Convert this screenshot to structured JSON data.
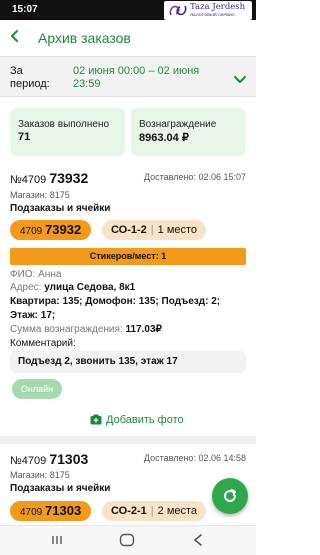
{
  "status_bar": {
    "time": "15:07"
  },
  "logo": {
    "brand": "Taza Jerdesh",
    "tagline": "НАЛОГОВЫЙ СЕРВИС"
  },
  "header": {
    "title": "Архив заказов"
  },
  "period": {
    "label": "За период:",
    "value": "02 июня 00:00 – 02 июня 23:59"
  },
  "stats": [
    {
      "label": "Заказов выполнено",
      "value": "71"
    },
    {
      "label": "Вознаграждение",
      "value": "8963.04 ₽"
    }
  ],
  "orders": [
    {
      "number_prefix": "№4709",
      "number_main": "73932",
      "delivered": "Доставлено: 02.06 15:07",
      "shop": "Магазин: 8175",
      "subtitle": "Подзаказы и ячейки",
      "code_prefix": "4709",
      "code_main": "73932",
      "cell": "СО-1-2",
      "places": "1 место",
      "stickers": "Стикеров/мест: 1",
      "fio_label": "ФИО:",
      "fio_value": "Анна",
      "address_label": "Адрес:",
      "address_value": "улица Седова, 8к1",
      "apartment_line": "Квартира: 135; Домофон: 135; Подъезд: 2;",
      "floor_line": "Этаж: 17;",
      "reward_label": "Сумма вознаграждения:",
      "reward_value": "117.03₽",
      "comment_label": "Комментарий:",
      "comment_value": "Подъезд 2, звонить 135, этаж 17",
      "online_label": "Онлайн",
      "add_photo_label": "Добавить фото"
    },
    {
      "number_prefix": "№4709",
      "number_main": "71303",
      "delivered": "Доставлено: 02.06 14:58",
      "shop": "Магазин: 8175",
      "subtitle": "Подзаказы и ячейки",
      "code_prefix": "4709",
      "code_main": "71303",
      "cell": "СО-2-1",
      "places": "2 места"
    }
  ],
  "colors": {
    "accent_green": "#1c8a3a",
    "stat_bg": "#e7f6e9",
    "orange": "#f39a1a",
    "cell_bg": "#f9e3c6"
  }
}
